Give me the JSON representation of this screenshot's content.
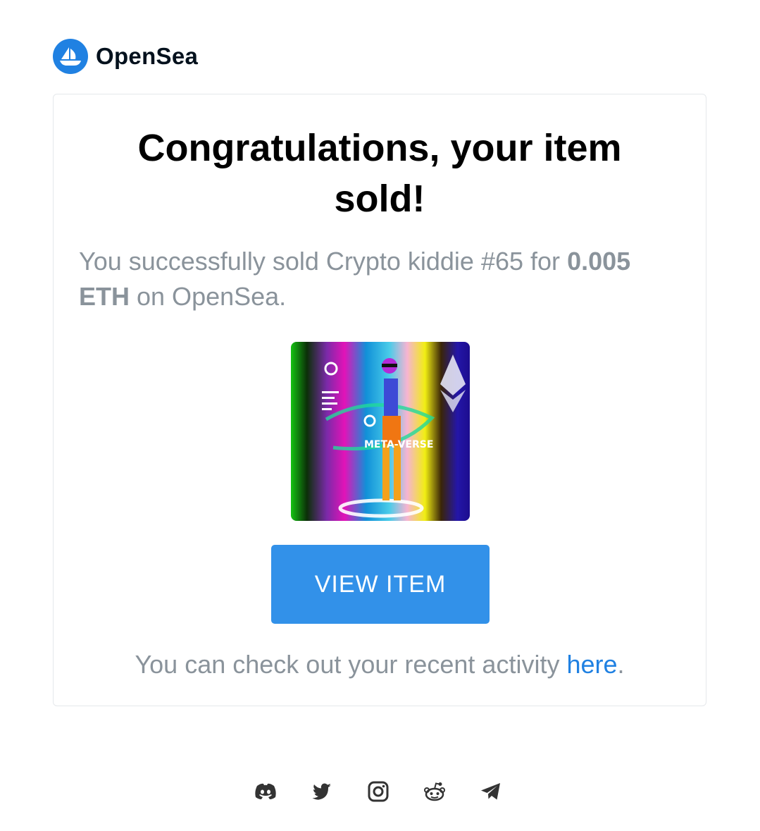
{
  "brand": {
    "name": "OpenSea",
    "logo_icon": "opensea-boat-icon",
    "color": "#2081e2"
  },
  "email": {
    "title": "Congratulations, your item sold!",
    "message_prefix": "You successfully sold Crypto kiddie #65 for",
    "price": "0.005 ETH",
    "message_suffix": "on OpenSea.",
    "item_image_alt": "Crypto kiddie #65",
    "item_image_text": "META-VERSE",
    "view_button_label": "VIEW ITEM",
    "activity_prefix": "You can check out your recent activity",
    "activity_link": "here",
    "activity_suffix": ".",
    "accent_color": "#3291e9"
  },
  "footer": {
    "socials": [
      {
        "icon": "discord-icon"
      },
      {
        "icon": "twitter-icon"
      },
      {
        "icon": "instagram-icon"
      },
      {
        "icon": "reddit-icon"
      },
      {
        "icon": "telegram-icon"
      }
    ]
  }
}
